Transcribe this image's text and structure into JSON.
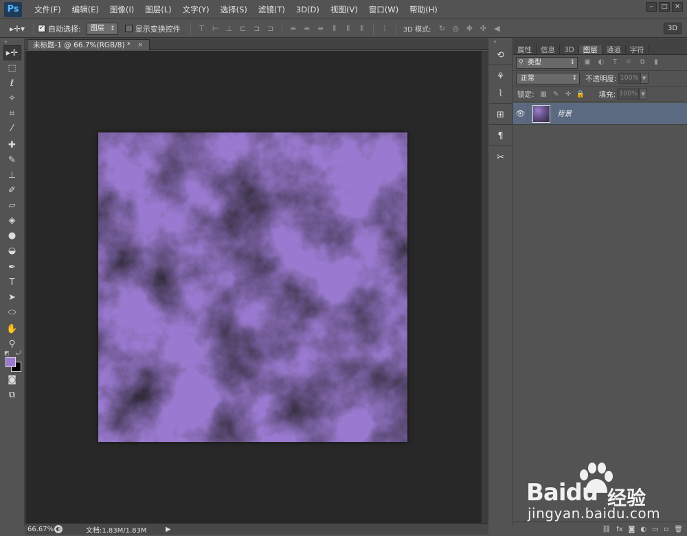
{
  "app": {
    "logo": "Ps"
  },
  "menu": [
    "文件(F)",
    "编辑(E)",
    "图像(I)",
    "图层(L)",
    "文字(Y)",
    "选择(S)",
    "滤镜(T)",
    "3D(D)",
    "视图(V)",
    "窗口(W)",
    "帮助(H)"
  ],
  "options": {
    "auto_select_label": "自动选择:",
    "auto_select_value": "图层",
    "show_transform_label": "显示变换控件",
    "mode3d_label": "3D 模式:",
    "btn3d_label": "3D"
  },
  "document": {
    "tab_title": "未标题-1 @ 66.7%(RGB/8) *",
    "zoom": "66.67%",
    "doc_size": "文档:1.83M/1.83M"
  },
  "colors": {
    "foreground": "#9a7ad0",
    "background": "#000000",
    "cloud_light": "#9a7ad0",
    "cloud_dark": "#2a2530",
    "layer_selected": "#5b6a80"
  },
  "panel": {
    "tabs": [
      "属性",
      "信息",
      "3D",
      "图层",
      "通道",
      "字符"
    ],
    "active_tab": "图层",
    "kind_filter": "类型",
    "blend_mode": "正常",
    "opacity_label": "不透明度:",
    "opacity_value": "100%",
    "lock_label": "锁定:",
    "fill_label": "填充:",
    "fill_value": "100%",
    "layers": [
      {
        "name": "背景",
        "visible": true
      }
    ]
  },
  "watermark": {
    "brand": "Bai",
    "brand2": "du",
    "cn": "经验",
    "url": "jingyan.baidu.com"
  }
}
